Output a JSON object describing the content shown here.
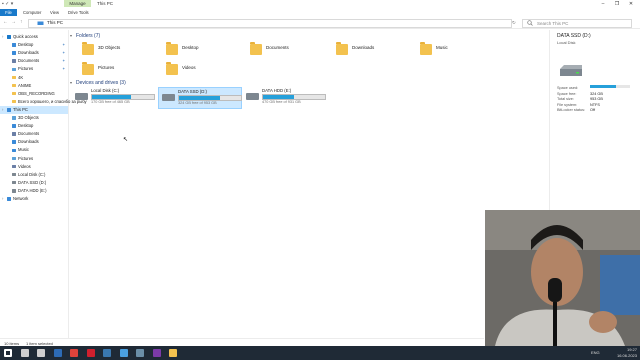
{
  "window": {
    "quick_access": "▪ ✓ ▾",
    "context_tab": "Manage",
    "title": "This PC",
    "controls": [
      "–",
      "❐",
      "✕"
    ]
  },
  "ribbon": {
    "tabs": [
      "File",
      "Computer",
      "View",
      "Drive Tools"
    ]
  },
  "address": {
    "back": "←",
    "forward": "→",
    "up": "↑",
    "path": "This PC",
    "search_placeholder": "Search This PC"
  },
  "nav": {
    "items": [
      {
        "label": "Quick access",
        "icon": "star-icon",
        "color": "#1979ca",
        "indent": 0
      },
      {
        "label": "Desktop",
        "icon": "desktop-icon",
        "color": "#3a8ad8",
        "indent": 1,
        "pinned": true
      },
      {
        "label": "Downloads",
        "icon": "download-icon",
        "color": "#3a8ad8",
        "indent": 1,
        "pinned": true
      },
      {
        "label": "Documents",
        "icon": "document-icon",
        "color": "#6b7fa6",
        "indent": 1,
        "pinned": true
      },
      {
        "label": "Pictures",
        "icon": "picture-icon",
        "color": "#5aa0d8",
        "indent": 1,
        "pinned": true
      },
      {
        "label": "4K",
        "icon": "folder-icon",
        "color": "#f3c24f",
        "indent": 1
      },
      {
        "label": "ANIME",
        "icon": "folder-icon",
        "color": "#f3c24f",
        "indent": 1
      },
      {
        "label": "OBS_RECORDING",
        "icon": "folder-icon",
        "color": "#f3c24f",
        "indent": 1
      },
      {
        "label": "Всего хорошего, и спасибо за рыбу",
        "icon": "folder-icon",
        "color": "#f3c24f",
        "indent": 1
      },
      {
        "label": "This PC",
        "icon": "computer-icon",
        "color": "#3a8ad8",
        "indent": 0,
        "selected": true
      },
      {
        "label": "3D Objects",
        "icon": "cube-icon",
        "color": "#5aa0d8",
        "indent": 1
      },
      {
        "label": "Desktop",
        "icon": "desktop-icon",
        "color": "#3a8ad8",
        "indent": 1
      },
      {
        "label": "Documents",
        "icon": "document-icon",
        "color": "#6b7fa6",
        "indent": 1
      },
      {
        "label": "Downloads",
        "icon": "download-icon",
        "color": "#3a8ad8",
        "indent": 1
      },
      {
        "label": "Music",
        "icon": "music-icon",
        "color": "#3a8ad8",
        "indent": 1
      },
      {
        "label": "Pictures",
        "icon": "picture-icon",
        "color": "#5aa0d8",
        "indent": 1
      },
      {
        "label": "Videos",
        "icon": "video-icon",
        "color": "#6b7fa6",
        "indent": 1
      },
      {
        "label": "Local Disk (C:)",
        "icon": "drive-icon",
        "color": "#7d8790",
        "indent": 1
      },
      {
        "label": "DATA SSD (D:)",
        "icon": "drive-icon",
        "color": "#7d8790",
        "indent": 1
      },
      {
        "label": "DATA HDD (E:)",
        "icon": "drive-icon",
        "color": "#7d8790",
        "indent": 1
      },
      {
        "label": "Network",
        "icon": "network-icon",
        "color": "#3a8ad8",
        "indent": 0
      }
    ]
  },
  "folders": {
    "title": "Folders (7)",
    "items": [
      "3D Objects",
      "Desktop",
      "Documents",
      "Downloads",
      "Music",
      "Pictures",
      "Videos"
    ]
  },
  "drives": {
    "title": "Devices and drives (3)",
    "items": [
      {
        "name": "Local Disk (C:)",
        "free": "170 GB free of 465 GB",
        "used_fraction": 0.63
      },
      {
        "name": "DATA SSD (D:)",
        "free": "324 GB free of 953 GB",
        "used_fraction": 0.66,
        "selected": true
      },
      {
        "name": "DATA HDD (E:)",
        "free": "470 GB free of 931 GB",
        "used_fraction": 0.5
      }
    ]
  },
  "details": {
    "title": "DATA SSD (D:)",
    "subtitle": "Local Disk",
    "props": [
      {
        "k": "Space used:",
        "v": ""
      },
      {
        "k": "Space free:",
        "v": "324 GB"
      },
      {
        "k": "Total size:",
        "v": "953 GB"
      },
      {
        "k": "File system:",
        "v": "NTFS"
      },
      {
        "k": "BitLocker status:",
        "v": "Off"
      }
    ],
    "used_fraction": 0.66
  },
  "status": {
    "count": "10 items",
    "selected": "1 item selected"
  },
  "taskbar": {
    "icons": [
      {
        "name": "start-icon",
        "color": "#ffffff"
      },
      {
        "name": "search-icon",
        "color": "#d0d0d0"
      },
      {
        "name": "task-view-icon",
        "color": "#d0d0d0"
      },
      {
        "name": "powershell-icon",
        "color": "#2d6bb5"
      },
      {
        "name": "chrome-icon",
        "color": "#e0433b"
      },
      {
        "name": "opera-icon",
        "color": "#d0202e"
      },
      {
        "name": "steam-icon",
        "color": "#3a78b0"
      },
      {
        "name": "app-icon",
        "color": "#4aa0e0"
      },
      {
        "name": "notepad-icon",
        "color": "#6b8fa8"
      },
      {
        "name": "onenote-icon",
        "color": "#7b3aa8"
      },
      {
        "name": "explorer-icon",
        "color": "#f3c24f"
      }
    ],
    "tray": "ENG",
    "time": "19:27",
    "date": "16.06.2023"
  }
}
